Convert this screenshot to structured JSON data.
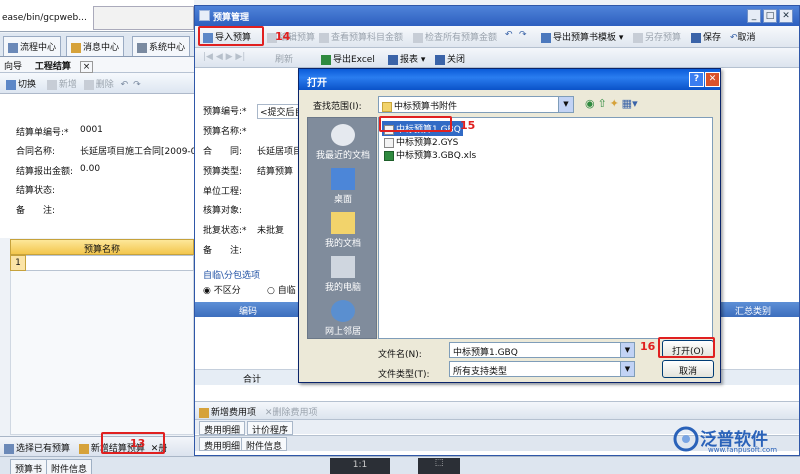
{
  "background_app": {
    "url_text": "ease/bin/gcpweb...",
    "tabs": [
      "流程中心",
      "消息中心",
      "系统中心"
    ],
    "subnav": {
      "guide": "向导",
      "section": "工程结算",
      "close": "×"
    },
    "toolbar": {
      "switch": "切换",
      "add": "新增",
      "delete": "删除"
    },
    "form": [
      {
        "label": "结算单编号:*",
        "value": "0001"
      },
      {
        "label": "合同名称:",
        "value": "长延居项目施工合同[2009-0"
      },
      {
        "label": "结算报出金额:",
        "value": "0.00"
      },
      {
        "label": "结算状态:",
        "value": ""
      },
      {
        "label": "备　　注:",
        "value": ""
      }
    ],
    "grid": {
      "header": "预算名称",
      "row_num": "1"
    },
    "bottom_bar": {
      "select_existing": "选择已有预算",
      "add_budget": "新增结算预算",
      "delete": "册"
    },
    "bottom_tabs": [
      "预算书",
      "附件信息"
    ],
    "status_a": "1:1"
  },
  "budget_window": {
    "title": "预算管理",
    "toolbar": {
      "import": "导入预算",
      "edit": "编辑预算",
      "view_items": "查看预算科目金额",
      "check_all": "检查所有预算金额",
      "export_template": "导出预算书模板",
      "save_as": "另存预算",
      "save": "保存",
      "cancel": "取消"
    },
    "toolbar2": {
      "refresh": "刷新",
      "export_excel": "导出Excel",
      "report": "报表",
      "close": "关闭"
    },
    "form": [
      {
        "label": "预算编号:*",
        "value": "<提交后自"
      },
      {
        "label": "预算名称:*",
        "value": ""
      },
      {
        "label": "合　　同:",
        "value": "长延居项目"
      },
      {
        "label": "预算类型:",
        "value": "结算预算"
      },
      {
        "label": "单位工程:",
        "value": ""
      },
      {
        "label": "核算对象:",
        "value": ""
      },
      {
        "label": "批复状态:*",
        "value": "未批复"
      },
      {
        "label": "备　　注:",
        "value": ""
      }
    ],
    "subcontract": {
      "title": "自临\\分包选项",
      "option1": "不区分",
      "option2": "自临"
    },
    "grid": {
      "col_code": "编码",
      "col_category": "汇总类别"
    },
    "total_label": "合计",
    "fee_toolbar": {
      "add_fee": "新增费用项",
      "delete_fee": "删除费用项"
    },
    "fee_tabs": [
      "费用明细",
      "计价程序"
    ],
    "bottom_tabs": [
      "费用明细",
      "附件信息"
    ]
  },
  "open_dialog": {
    "title": "打开",
    "look_in_label": "查找范围(I):",
    "look_in_value": "中标预算书附件",
    "places": [
      "我最近的文档",
      "桌面",
      "我的文档",
      "我的电脑",
      "网上邻居"
    ],
    "files": [
      {
        "name": "中标预算1.GBQ",
        "selected": true
      },
      {
        "name": "中标预算2.GYS",
        "selected": false
      },
      {
        "name": "中标预算3.GBQ.xls",
        "selected": false
      }
    ],
    "filename_label": "文件名(N):",
    "filename_value": "中标预算1.GBQ",
    "filetype_label": "文件类型(T):",
    "filetype_value": "所有支持类型",
    "open_button": "打开(O)",
    "cancel_button": "取消"
  },
  "annotations": {
    "step14": "14",
    "step15": "15",
    "step16": "16",
    "step13": "13"
  },
  "logo": {
    "name": "泛普软件",
    "url": "www.fanpusoft.com"
  },
  "colors": {
    "title_blue": "#2d5fbf",
    "xp_title": "#0a5bd8",
    "annotation_red": "#e02020",
    "selection": "#316ac5"
  }
}
